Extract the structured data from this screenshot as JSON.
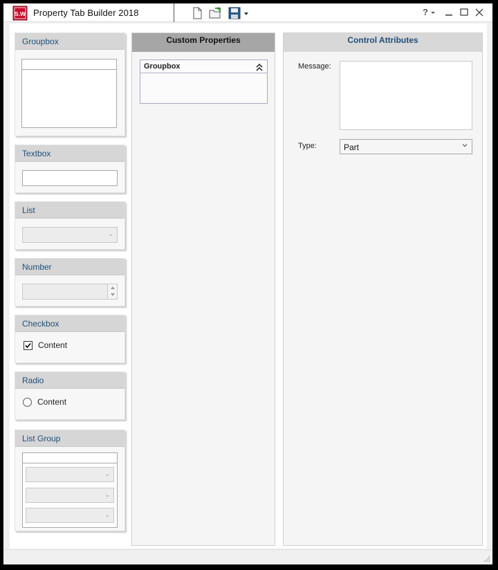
{
  "window": {
    "title": "Property Tab Builder   2018",
    "logo_text": "S.W"
  },
  "toolbar": {
    "icons": [
      "new-document-icon",
      "open-folder-icon",
      "save-icon",
      "dropdown-arrow-icon"
    ],
    "help_label": "?",
    "controls": [
      "minimize-icon",
      "maximize-icon",
      "close-icon"
    ]
  },
  "palette": {
    "groupbox": {
      "title": "Groupbox"
    },
    "textbox": {
      "title": "Textbox"
    },
    "list": {
      "title": "List"
    },
    "number": {
      "title": "Number"
    },
    "checkbox": {
      "title": "Checkbox",
      "label": "Content",
      "checked": true
    },
    "radio": {
      "title": "Radio",
      "label": "Content",
      "selected": false
    },
    "list_group": {
      "title": "List Group"
    }
  },
  "custom_properties": {
    "title": "Custom Properties",
    "groupbox": {
      "label": "Groupbox",
      "collapse_icon": "double-chevron-up-icon"
    }
  },
  "control_attributes": {
    "title": "Control Attributes",
    "message_label": "Message:",
    "message_value": "",
    "type_label": "Type:",
    "type_value": "Part"
  },
  "colors": {
    "header_text": "#1f4e79",
    "card_header_bg": "#d6d6d6",
    "custom_properties_header_bg": "#a6a6a6",
    "logo_red": "#c8102e"
  }
}
